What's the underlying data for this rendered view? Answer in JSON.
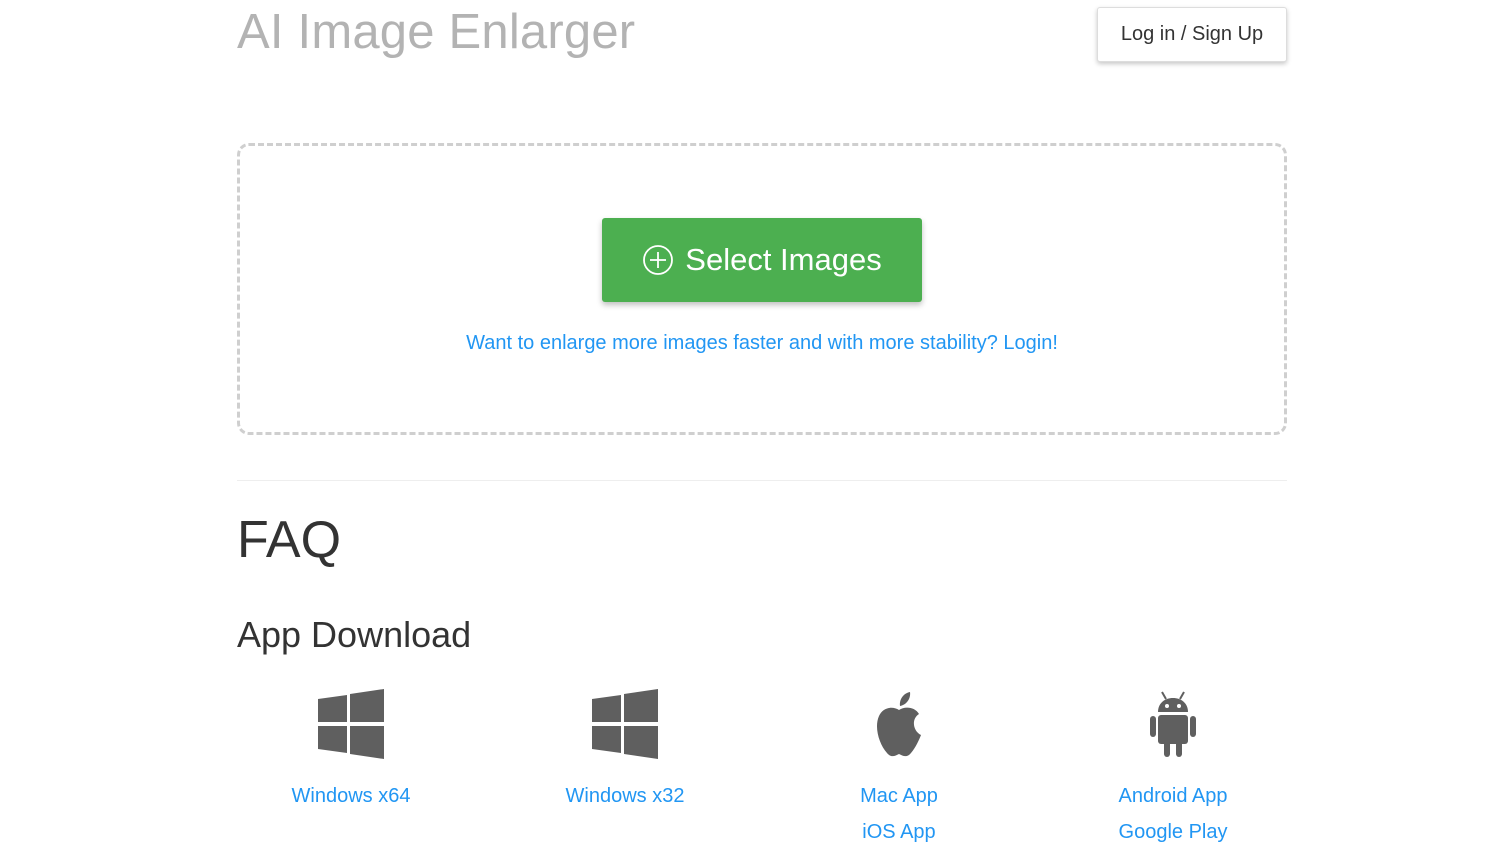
{
  "header": {
    "title": "AI Image Enlarger",
    "login_label": "Log in / Sign Up"
  },
  "upload": {
    "select_label": "Select Images",
    "login_hint": "Want to enlarge more images faster and with more stability? Login!"
  },
  "faq": {
    "title": "FAQ"
  },
  "downloads": {
    "title": "App Download",
    "apps": [
      {
        "icon": "windows-icon",
        "links": [
          "Windows x64"
        ]
      },
      {
        "icon": "windows-icon",
        "links": [
          "Windows x32"
        ]
      },
      {
        "icon": "apple-icon",
        "links": [
          "Mac App",
          "iOS App"
        ]
      },
      {
        "icon": "android-icon",
        "links": [
          "Android App",
          "Google Play"
        ]
      }
    ]
  },
  "colors": {
    "accent_green": "#4caf50",
    "link_blue": "#2196f3",
    "title_gray": "#b3b3b3",
    "icon_gray": "#5f5f5f"
  }
}
